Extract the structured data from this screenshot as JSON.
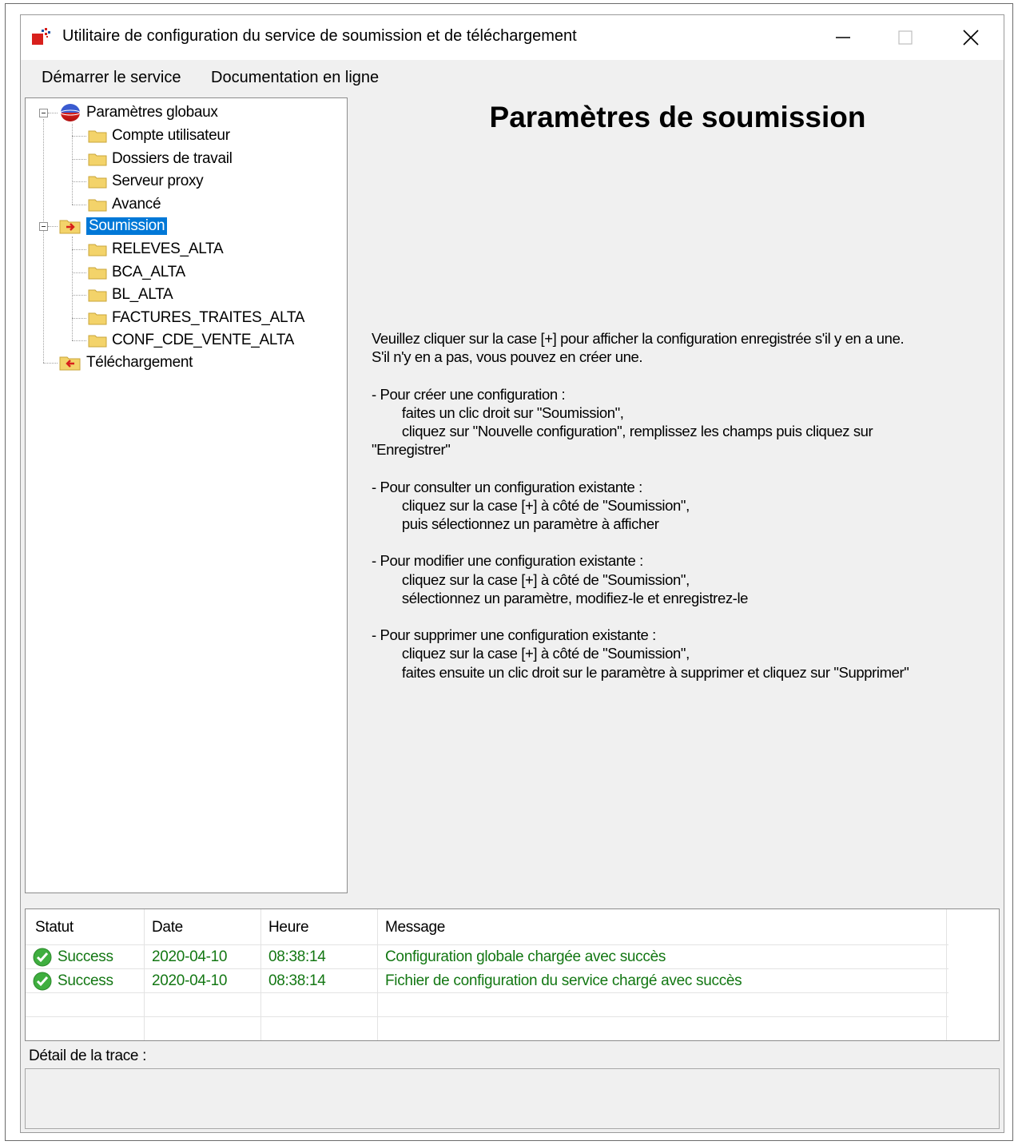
{
  "window": {
    "title": "Utilitaire de configuration du service de soumission et de téléchargement"
  },
  "menu": [
    {
      "label": "Démarrer le service"
    },
    {
      "label": "Documentation en ligne"
    }
  ],
  "tree": {
    "global": {
      "label": "Paramètres globaux",
      "children": [
        "Compte utilisateur",
        "Dossiers de travail",
        "Serveur proxy",
        "Avancé"
      ]
    },
    "submission": {
      "label": "Soumission",
      "children": [
        "RELEVES_ALTA",
        "BCA_ALTA",
        "BL_ALTA",
        "FACTURES_TRAITES_ALTA",
        "CONF_CDE_VENTE_ALTA"
      ]
    },
    "download": {
      "label": "Téléchargement"
    }
  },
  "panel": {
    "heading": "Paramètres de soumission",
    "help_text": "Veuillez cliquer sur la case [+] pour afficher la configuration enregistrée s'il y en a une.\nS'il n'y en a pas, vous pouvez en créer une.\n\n- Pour créer une configuration :\n        faites un clic droit sur \"Soumission\",\n        cliquez sur \"Nouvelle configuration\", remplissez les champs puis cliquez sur\n\"Enregistrer\"\n\n- Pour consulter un configuration existante :\n        cliquez sur la case [+] à côté de \"Soumission\",\n        puis sélectionnez un paramètre à afficher\n\n- Pour modifier une configuration existante :\n        cliquez sur la case [+] à côté de \"Soumission\",\n        sélectionnez un paramètre, modifiez-le et enregistrez-le\n\n- Pour supprimer une configuration existante :\n        cliquez sur la case [+] à côté de \"Soumission\",\n        faites ensuite un clic droit sur le paramètre à supprimer et cliquez sur \"Supprimer\""
  },
  "log": {
    "columns": [
      "Statut",
      "Date",
      "Heure",
      "Message"
    ],
    "rows": [
      {
        "status": "Success",
        "date": "2020-04-10",
        "time": "08:38:14",
        "message": "Configuration globale chargée avec succès"
      },
      {
        "status": "Success",
        "date": "2020-04-10",
        "time": "08:38:14",
        "message": "Fichier de configuration du service chargé avec succès"
      }
    ]
  },
  "trace": {
    "label": "Détail de la trace :",
    "value": ""
  },
  "colors": {
    "accent": "#0078d7",
    "success_text": "#137713",
    "folder": "#f3d36a"
  }
}
